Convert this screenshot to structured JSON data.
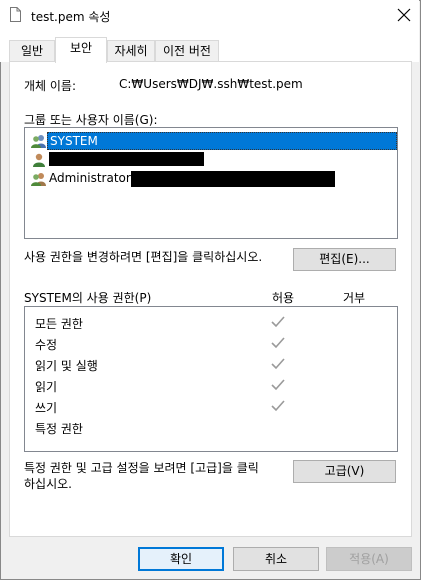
{
  "window": {
    "title": "test.pem 속성"
  },
  "tabs": [
    {
      "label": "일반"
    },
    {
      "label": "보안"
    },
    {
      "label": "자세히"
    },
    {
      "label": "이전 버전"
    }
  ],
  "security": {
    "object_name_label": "개체 이름:",
    "object_name_value": "C:₩Users₩DJ₩.ssh₩test.pem",
    "group_label": "그룹 또는 사용자 이름(G):",
    "users": [
      {
        "name": "SYSTEM",
        "selected": true,
        "icon": "users-group-icon"
      },
      {
        "name": "",
        "selected": false,
        "redacted": true,
        "icon": "user-icon"
      },
      {
        "name": "Administrators",
        "selected": false,
        "redacted": true,
        "icon": "users-group-icon"
      }
    ],
    "edit_hint": "사용 권한을 변경하려면 [편집]을 클릭하십시오.",
    "edit_button": "편집(E)...",
    "permissions_label": "SYSTEM의 사용 권한(P)",
    "allow_header": "허용",
    "deny_header": "거부",
    "permissions": [
      {
        "name": "모든 권한",
        "allow": true,
        "deny": false
      },
      {
        "name": "수정",
        "allow": true,
        "deny": false
      },
      {
        "name": "읽기 및 실행",
        "allow": true,
        "deny": false
      },
      {
        "name": "읽기",
        "allow": true,
        "deny": false
      },
      {
        "name": "쓰기",
        "allow": true,
        "deny": false
      },
      {
        "name": "특정 권한",
        "allow": false,
        "deny": false
      }
    ],
    "advanced_hint_line1": "특정 권한 및 고급 설정을 보려면 [고급]을 클릭",
    "advanced_hint_line2": "하십시오.",
    "advanced_button": "고급(V)"
  },
  "footer": {
    "ok": "확인",
    "cancel": "취소",
    "apply": "적용(A)"
  },
  "colors": {
    "accent": "#0078d7",
    "check_gray": "#9a9a9a"
  }
}
